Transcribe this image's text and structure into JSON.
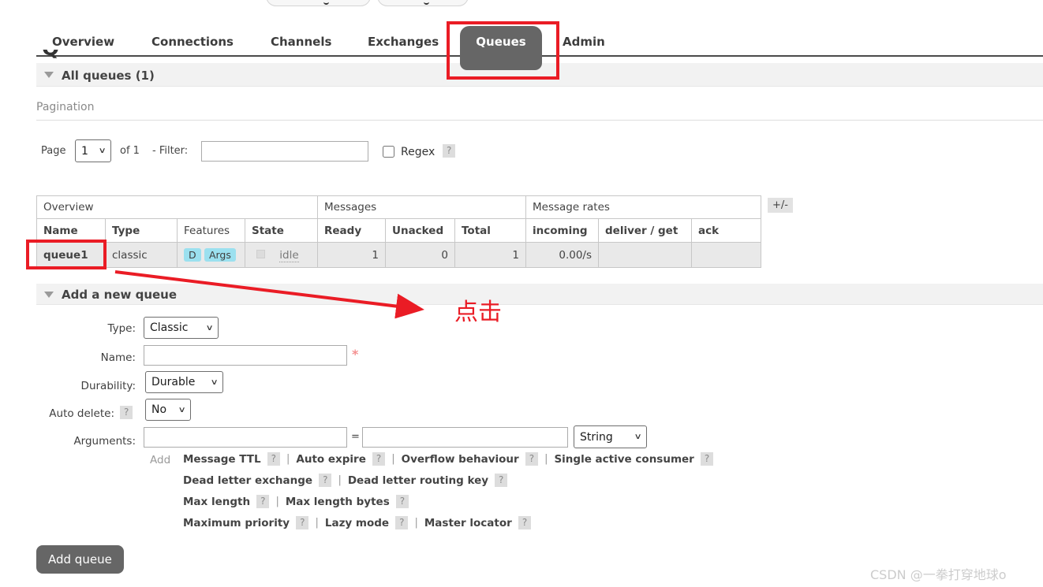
{
  "ui": {
    "help": "?"
  },
  "nav": {
    "tabs": [
      {
        "label": "Overview"
      },
      {
        "label": "Connections"
      },
      {
        "label": "Channels"
      },
      {
        "label": "Exchanges"
      },
      {
        "label": "Queues"
      },
      {
        "label": "Admin"
      }
    ],
    "active_tab": "Queues"
  },
  "sections": {
    "all_queues": "All queues (1)",
    "pagination": "Pagination",
    "add_queue": "Add a new queue"
  },
  "pagination": {
    "page_label": "Page",
    "page_value": "1",
    "of_label": "of 1",
    "filter_label": "- Filter:",
    "filter_value": "",
    "regex_label": "Regex"
  },
  "table": {
    "groups": [
      "Overview",
      "Messages",
      "Message rates"
    ],
    "plusminus": "+/-",
    "columns": [
      "Name",
      "Type",
      "Features",
      "State",
      "Ready",
      "Unacked",
      "Total",
      "incoming",
      "deliver / get",
      "ack"
    ],
    "row": {
      "name": "queue1",
      "type": "classic",
      "features": [
        "D",
        "Args"
      ],
      "state": "idle",
      "ready": "1",
      "unacked": "0",
      "total": "1",
      "incoming": "0.00/s",
      "deliver_get": "",
      "ack": ""
    }
  },
  "annotation": {
    "click_text": "点击"
  },
  "form": {
    "type_label": "Type:",
    "type_value": "Classic",
    "name_label": "Name:",
    "name_value": "",
    "required_marker": "*",
    "durability_label": "Durability:",
    "durability_value": "Durable",
    "auto_delete_label": "Auto delete:",
    "auto_delete_value": "No",
    "arguments_label": "Arguments:",
    "arg_key_value": "",
    "arg_val_value": "",
    "arg_type_value": "String",
    "add_label": "Add",
    "arg_links": [
      "Message TTL",
      "Auto expire",
      "Overflow behaviour",
      "Single active consumer",
      "Dead letter exchange",
      "Dead letter routing key",
      "Max length",
      "Max length bytes",
      "Maximum priority",
      "Lazy mode",
      "Master locator"
    ],
    "submit_label": "Add queue"
  },
  "watermark": "CSDN @一拳打穿地球o"
}
